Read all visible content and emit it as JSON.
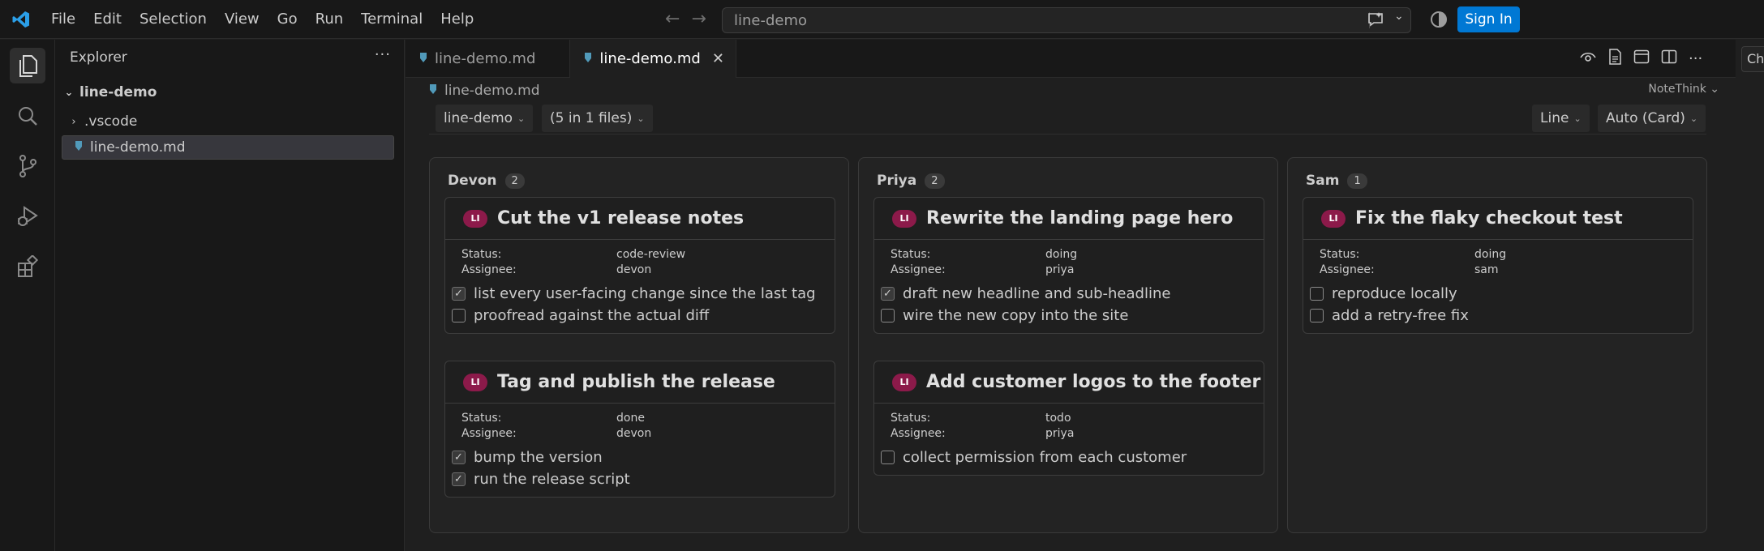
{
  "menu": [
    "File",
    "Edit",
    "Selection",
    "View",
    "Go",
    "Run",
    "Terminal",
    "Help"
  ],
  "command_center": {
    "text": "line-demo"
  },
  "signin": {
    "label": "Sign In"
  },
  "sidebar": {
    "title": "Explorer",
    "root": "line-demo",
    "items": [
      {
        "label": ".vscode"
      },
      {
        "label": "line-demo.md"
      }
    ]
  },
  "tabs": [
    {
      "label": "line-demo.md"
    },
    {
      "label": "line-demo.md"
    }
  ],
  "chat_stub": "Ch",
  "editor": {
    "breadcrumb": "line-demo.md",
    "extension": "NoteThink",
    "toolbar": {
      "scope": "line-demo",
      "files": "(5 in 1 files)",
      "mode": "Line",
      "view": "Auto (Card)"
    }
  },
  "board": {
    "status_label": "Status:",
    "assignee_label": "Assignee:",
    "badge": "LI",
    "columns": [
      {
        "name": "Devon",
        "count": "2",
        "cards": [
          {
            "title": "Cut the v1 release notes",
            "status": "code-review",
            "assignee": "devon",
            "tasks": [
              {
                "text": "list every user-facing change since the last tag",
                "checked": true
              },
              {
                "text": "proofread against the actual diff",
                "checked": false
              }
            ]
          },
          {
            "title": "Tag and publish the release",
            "status": "done",
            "assignee": "devon",
            "tasks": [
              {
                "text": "bump the version",
                "checked": true
              },
              {
                "text": "run the release script",
                "checked": true
              }
            ]
          }
        ]
      },
      {
        "name": "Priya",
        "count": "2",
        "cards": [
          {
            "title": "Rewrite the landing page hero",
            "status": "doing",
            "assignee": "priya",
            "tasks": [
              {
                "text": "draft new headline and sub-headline",
                "checked": true
              },
              {
                "text": "wire the new copy into the site",
                "checked": false
              }
            ]
          },
          {
            "title": "Add customer logos to the footer",
            "status": "todo",
            "assignee": "priya",
            "tasks": [
              {
                "text": "collect permission from each customer",
                "checked": false
              }
            ]
          }
        ]
      },
      {
        "name": "Sam",
        "count": "1",
        "cards": [
          {
            "title": "Fix the flaky checkout test",
            "status": "doing",
            "assignee": "sam",
            "tasks": [
              {
                "text": "reproduce locally",
                "checked": false
              },
              {
                "text": "add a retry-free fix",
                "checked": false
              }
            ]
          }
        ]
      }
    ]
  },
  "colors": {
    "accent": "#0078d4",
    "badge": "#8c1a4a",
    "background": "#1f1f1f"
  }
}
